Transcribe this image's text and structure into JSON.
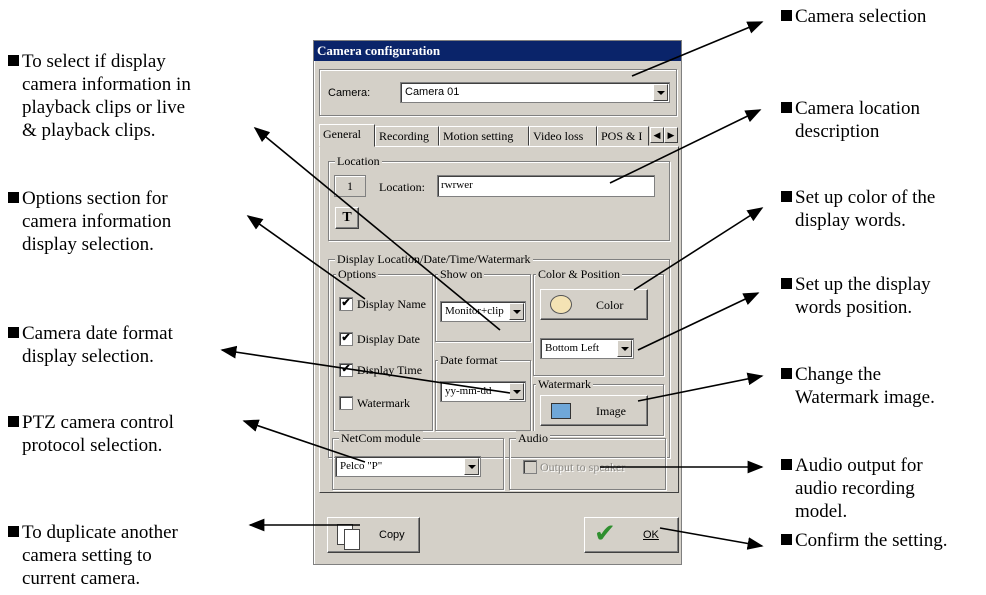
{
  "annotations": {
    "left": [
      "To select if display\ncamera information in\nplayback clips or live\n& playback clips.",
      "Options section for\ncamera information\ndisplay selection.",
      "Camera date format\ndisplay selection.",
      "PTZ camera control\nprotocol selection.",
      "To duplicate another\ncamera setting to\ncurrent camera."
    ],
    "right": [
      "Camera selection",
      "Camera location\ndescription",
      "Set up color of the\ndisplay words.",
      "Set up the display\nwords position.",
      "Change the\nWatermark image.",
      "Audio output for\naudio recording\nmodel.",
      "Confirm the setting."
    ]
  },
  "dialog": {
    "title": "Camera configuration",
    "camera_label": "Camera:",
    "camera_value": "Camera 01",
    "tabs": [
      "General",
      "Recording",
      "Motion setting",
      "Video loss",
      "POS & I"
    ],
    "location": {
      "group_label": "Location",
      "number": "1",
      "label": "Location:",
      "value": "rwrwer"
    },
    "display": {
      "group_label": "Display Location/Date/Time/Watermark",
      "options_label": "Options",
      "options": [
        {
          "label": "Display Name",
          "checked": "✔"
        },
        {
          "label": "Display Date",
          "checked": "✔"
        },
        {
          "label": "Display Time",
          "checked": "✔"
        },
        {
          "label": "Watermark",
          "checked": ""
        }
      ],
      "show_on_label": "Show on",
      "show_on_value": "Monitor+clip",
      "date_format_label": "Date format",
      "date_format_value": "yy-mm-dd",
      "color_position_label": "Color & Position",
      "color_button": "Color",
      "position_value": "Bottom Left",
      "watermark_label": "Watermark",
      "image_button": "Image"
    },
    "netcom": {
      "label": "NetCom module",
      "value": "Pelco \"P\""
    },
    "audio": {
      "label": "Audio",
      "output_label": "Output to speaker"
    },
    "copy_button": "Copy",
    "ok_button": "OK"
  }
}
